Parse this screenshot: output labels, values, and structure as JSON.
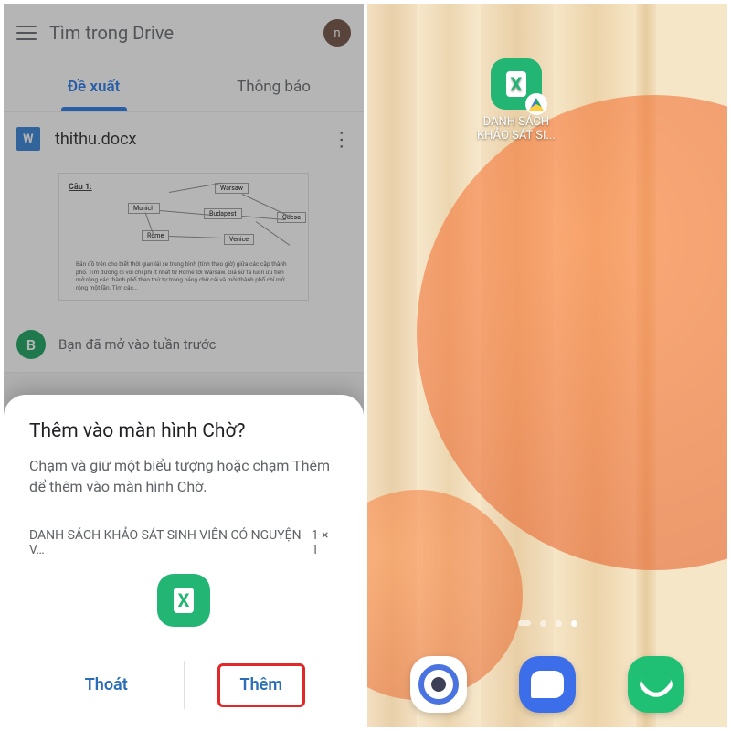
{
  "left": {
    "search_placeholder": "Tìm trong Drive",
    "avatar_letter": "n",
    "tabs": {
      "suggested": "Đề xuất",
      "notifications": "Thông báo"
    },
    "file": {
      "icon_letter": "W",
      "name": "thithu.docx"
    },
    "preview": {
      "q_label": "Câu 1:",
      "nodes": [
        "Warsaw",
        "Munich",
        "Budapest",
        "Odesa",
        "Rome",
        "Venice"
      ],
      "paragraph": "Bản đồ trên cho biết thời gian lái xe trung bình (tính theo giờ) giữa các cặp thành phố. Tìm đường đi với chi phí ít nhất từ Rome tới Warsaw. Giả sử ta luôn ưu tiên mở rộng các thành phố theo thứ tự trong bảng chữ cái và mỗi thành phố chỉ mở rộng một lần. Tìm các..."
    },
    "opened": {
      "avatar_letter": "B",
      "text": "Bạn đã mở vào tuần trước"
    },
    "sheet": {
      "title": "Thêm vào màn hình Chờ?",
      "desc": "Chạm và giữ một biểu tượng hoặc chạm Thêm để thêm vào màn hình Chờ.",
      "file_label": "DANH SÁCH KHẢO SÁT SINH VIÊN CÓ NGUYỆN V…",
      "size_hint": "1 × 1",
      "icon_letter": "X",
      "cancel": "Thoát",
      "add": "Thêm"
    }
  },
  "right": {
    "shortcut": {
      "icon_letter": "X",
      "line1": "DANH SÁCH",
      "line2": "KHẢO SÁT SI..."
    },
    "dock": {
      "browser": "browser",
      "messages": "messages",
      "phone": "phone"
    }
  }
}
